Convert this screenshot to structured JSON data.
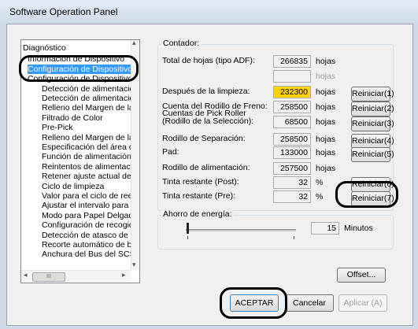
{
  "window": {
    "title": "Software Operation Panel"
  },
  "tree": {
    "items": [
      "Diagnóstico",
      "Información de Dispositivo",
      "Configuración de Dispositivo",
      "Configuración de Dispositivo",
      "Detección de alimentación",
      "Detección de alimentación",
      "Relleno del Margen de la F",
      "Filtrado de Color",
      "Pre-Pick",
      "Relleno del Margen de la F",
      "Especificación del área de",
      "Función de alimentación m",
      "Reintentos de alimentación",
      "Retener ajuste actual del g",
      "Ciclo de limpieza",
      "Valor para el ciclo de reemp",
      "Ajustar el intervalo para la",
      "Modo para Papel Delgado",
      "Configuración de recogida",
      "Detección de atasco de pa",
      "Recorte automático de bor",
      "Anchura del Bus del SCSI"
    ],
    "selected_index": 2
  },
  "contador": {
    "group_label": "Contador:",
    "rows": [
      {
        "label": "Total de hojas (tipo ADF):",
        "value": "266835",
        "unit": "hojas"
      },
      {
        "label": "",
        "value": "",
        "unit": "hojas"
      },
      {
        "label": "Después de la limpieza:",
        "value": "232300",
        "unit": "hojas",
        "button": "Reiniciar(1)"
      },
      {
        "label": "Cuenta del Rodillo de Freno:",
        "value": "258500",
        "unit": "hojas",
        "button": "Reiniciar(2)"
      },
      {
        "label": "Cuentas de Pick Roller (Rodillo de la  Selección):",
        "value": "68500",
        "unit": "hojas",
        "button": "Reiniciar(3)"
      },
      {
        "label": "Rodillo de Separación:",
        "value": "258500",
        "unit": "hojas",
        "button": "Reiniciar(4)"
      },
      {
        "label": "Pad:",
        "value": "133000",
        "unit": "hojas",
        "button": "Reiniciar(5)"
      },
      {
        "label": "Rodillo de alimentación:",
        "value": "257500",
        "unit": "hojas"
      },
      {
        "label": "Tinta restante (Post):",
        "value": "32",
        "unit": "%",
        "button": "Reiniciar(6)"
      },
      {
        "label": "Tinta restante (Pre):",
        "value": "32",
        "unit": "%",
        "button": "Reiniciar(7)"
      }
    ]
  },
  "energia": {
    "group_label": "Ahorro de energía:",
    "value": "15",
    "unit": "Minutos",
    "slider_fraction": 0.0
  },
  "buttons": {
    "offset": "Offset...",
    "ok": "ACEPTAR",
    "cancel": "Cancelar",
    "apply": "Aplicar (A)"
  },
  "scroll": {
    "left_arrow": "◂",
    "right_arrow": "▸",
    "up_arrow": "▴",
    "down_arrow": "▾",
    "thumb": "III"
  }
}
